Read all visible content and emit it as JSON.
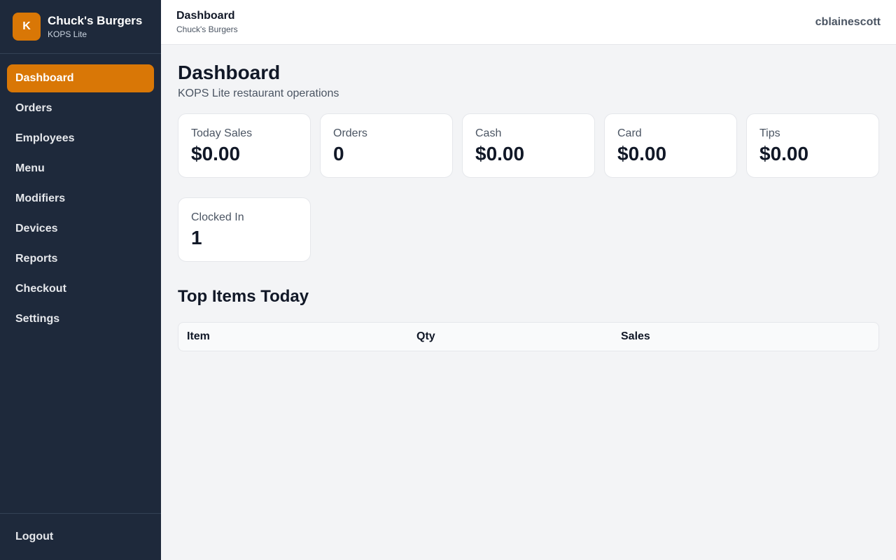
{
  "brand": {
    "logo_letter": "K",
    "name": "Chuck's Burgers",
    "subtitle": "KOPS Lite"
  },
  "sidebar": {
    "items": [
      {
        "label": "Dashboard",
        "active": true
      },
      {
        "label": "Orders"
      },
      {
        "label": "Employees"
      },
      {
        "label": "Menu"
      },
      {
        "label": "Modifiers"
      },
      {
        "label": "Devices"
      },
      {
        "label": "Reports"
      },
      {
        "label": "Checkout"
      },
      {
        "label": "Settings"
      }
    ],
    "logout_label": "Logout"
  },
  "topbar": {
    "title": "Dashboard",
    "subtitle": "Chuck's Burgers",
    "user": "cblainescott"
  },
  "page": {
    "title": "Dashboard",
    "subtitle": "KOPS Lite restaurant operations"
  },
  "cards": [
    {
      "label": "Today Sales",
      "value": "$0.00"
    },
    {
      "label": "Orders",
      "value": "0"
    },
    {
      "label": "Cash",
      "value": "$0.00"
    },
    {
      "label": "Card",
      "value": "$0.00"
    },
    {
      "label": "Tips",
      "value": "$0.00"
    },
    {
      "label": "Clocked In",
      "value": "1"
    }
  ],
  "top_items": {
    "title": "Top Items Today",
    "columns": [
      "Item",
      "Qty",
      "Sales"
    ],
    "rows": []
  },
  "colors": {
    "accent": "#d97706",
    "sidebar_bg": "#1e293b"
  }
}
